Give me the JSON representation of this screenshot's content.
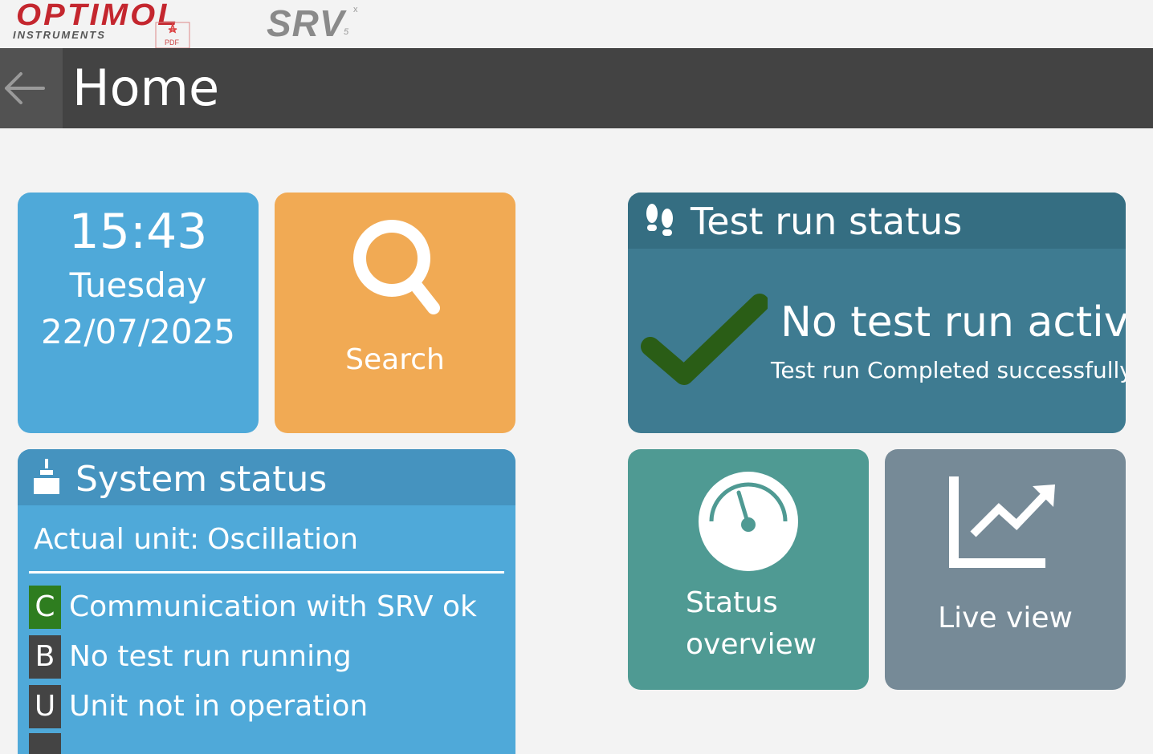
{
  "brand": {
    "logo_name": "OPTIMOL",
    "logo_sub": "INSTRUMENTS",
    "product": "SRV",
    "product_sup": "x",
    "product_sub": "5",
    "pdf_label": "PDF"
  },
  "header": {
    "title": "Home",
    "back_icon": "arrow-left-icon"
  },
  "clock": {
    "time": "15:43",
    "day": "Tuesday",
    "date": "22/07/2025"
  },
  "search": {
    "label": "Search",
    "icon": "magnifier-icon"
  },
  "system_status": {
    "title": "System status",
    "icon": "machine-icon",
    "unit_label": "Actual unit:",
    "unit_value": "Oscillation",
    "items": [
      {
        "badge": "C",
        "text": "Communication with SRV ok",
        "color": "#2e7d1f"
      },
      {
        "badge": "B",
        "text": "No test run running",
        "color": "#444444"
      },
      {
        "badge": "U",
        "text": "Unit not in operation",
        "color": "#444444"
      }
    ]
  },
  "test_run": {
    "title": "Test run status",
    "icon": "footsteps-icon",
    "status": "No test run active",
    "detail": "Test run Completed successfully",
    "check_color": "#2a5d16"
  },
  "overview": {
    "label_line1": "Status",
    "label_line2": "overview",
    "icon": "gauge-icon"
  },
  "live_view": {
    "label": "Live view",
    "icon": "trend-chart-icon"
  },
  "colors": {
    "clock_tile": "#4fa9d9",
    "search_tile": "#f1aa54",
    "test_run_tile": "#3e7b91",
    "overview_tile": "#4f9a93",
    "live_tile": "#768a97",
    "header_bar": "#434343"
  }
}
